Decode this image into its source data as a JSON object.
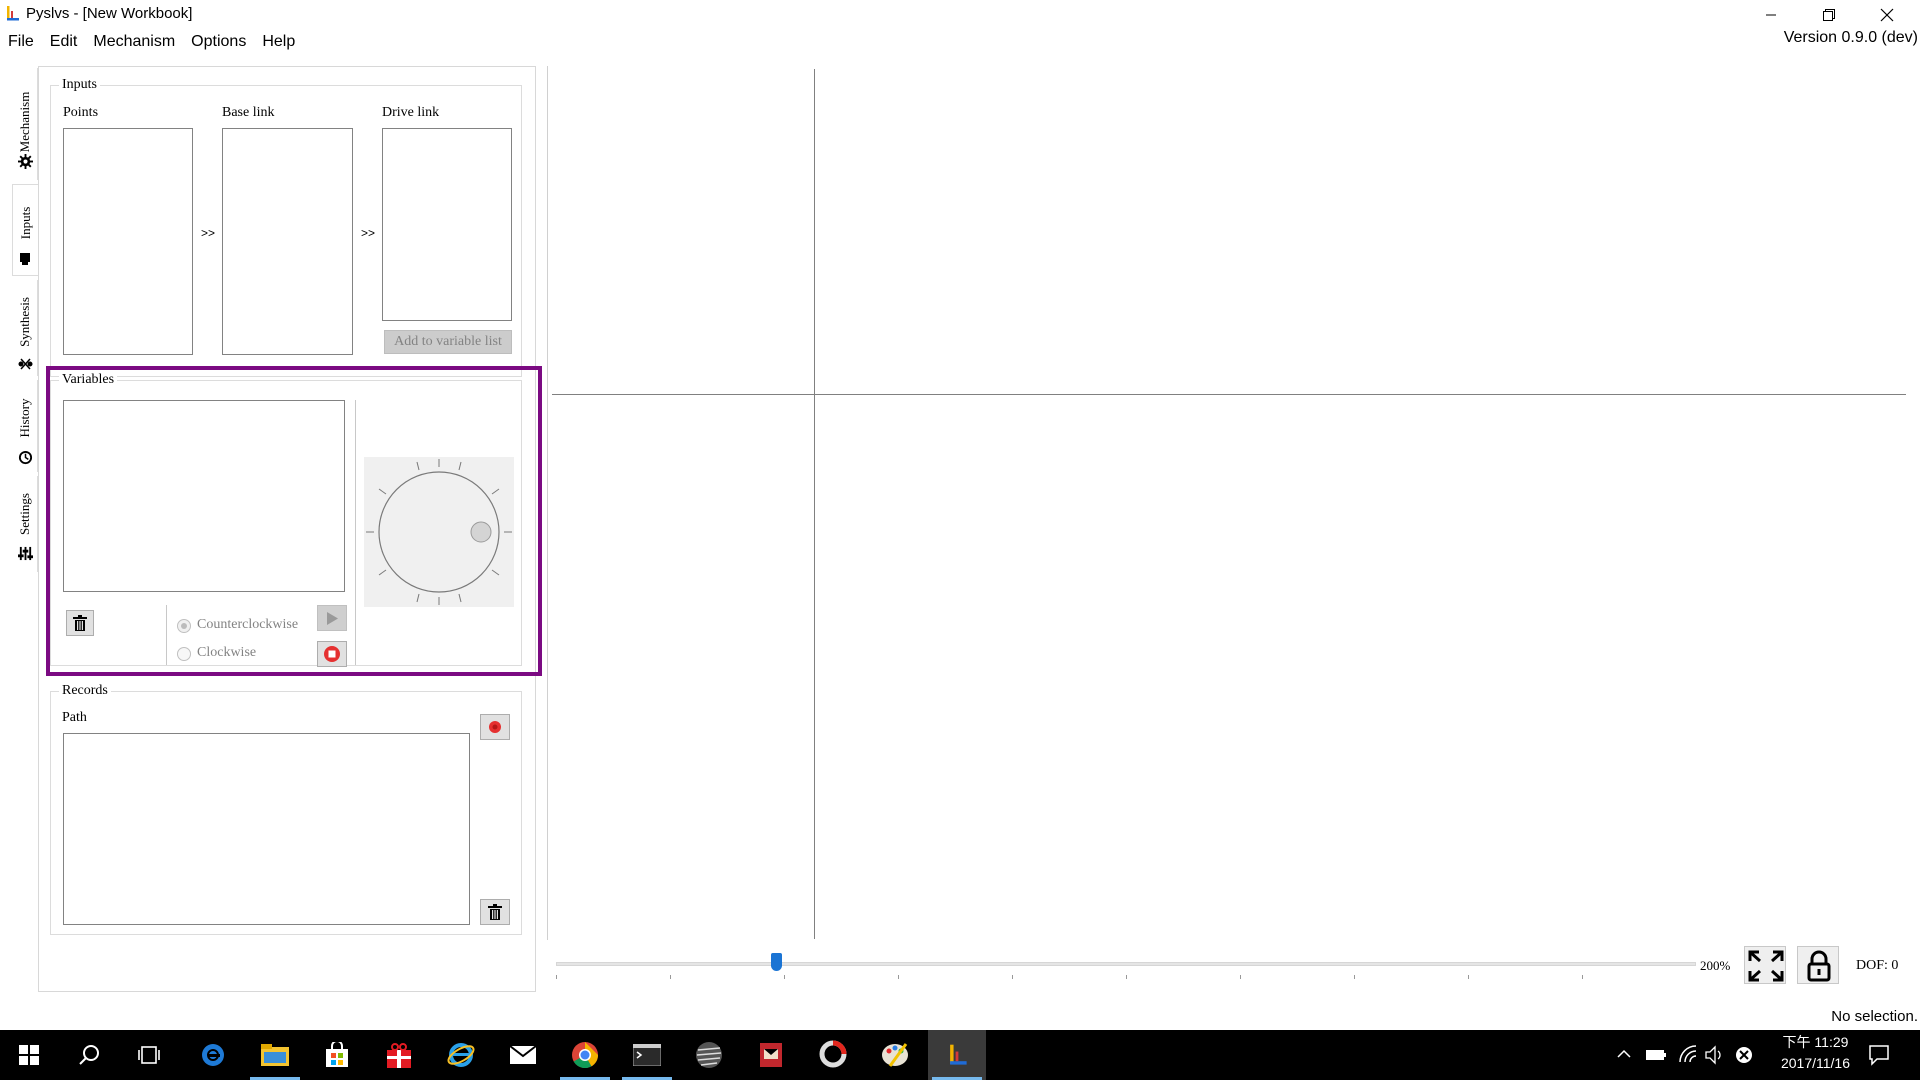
{
  "window": {
    "title": "Pyslvs - [New Workbook]",
    "version": "Version 0.9.0 (dev)"
  },
  "menu": [
    "File",
    "Edit",
    "Mechanism",
    "Options",
    "Help"
  ],
  "side_tabs": [
    {
      "label": "Mechanism",
      "icon": "gear-icon"
    },
    {
      "label": "Inputs",
      "icon": "input-icon",
      "active": true
    },
    {
      "label": "Synthesis",
      "icon": "synthesis-icon"
    },
    {
      "label": "History",
      "icon": "history-icon"
    },
    {
      "label": "Settings",
      "icon": "settings-icon"
    }
  ],
  "inputs": {
    "group_title": "Inputs",
    "points_label": "Points",
    "base_link_label": "Base link",
    "drive_link_label": "Drive link",
    "arrow": ">>",
    "add_button": "Add to variable list"
  },
  "variables": {
    "group_title": "Variables",
    "counterclockwise": "Counterclockwise",
    "clockwise": "Clockwise"
  },
  "records": {
    "group_title": "Records",
    "path_label": "Path"
  },
  "zoom": {
    "value": "200%",
    "level_percent": 200
  },
  "dof": "DOF: 0",
  "status": "No selection.",
  "taskbar": {
    "time": "下午 11:29",
    "date": "2017/11/16"
  },
  "colors": {
    "highlight": "#7b0a82",
    "slider_thumb": "#1a74d4",
    "record_red": "#e53030"
  }
}
